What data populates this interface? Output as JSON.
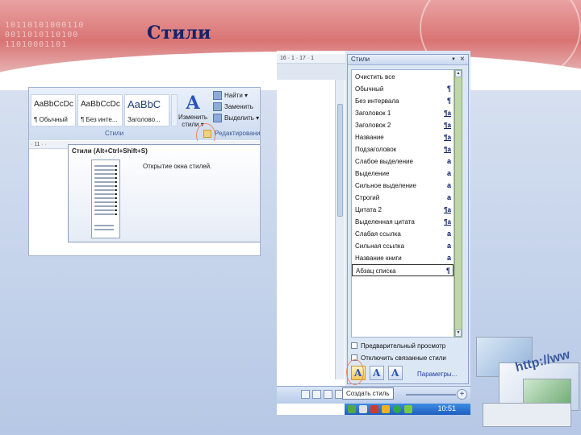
{
  "slide": {
    "title": "Стили",
    "banner_digits": [
      "10110101000110",
      "0011010110100",
      "11010001101"
    ],
    "illustration_text": "http://ww"
  },
  "left_screenshot": {
    "gallery": [
      {
        "sample": "AaBbCcDc",
        "name": "¶ Обычный"
      },
      {
        "sample": "AaBbCcDc",
        "name": "¶ Без инте..."
      },
      {
        "sample": "AaBbC",
        "name": "Заголово..."
      }
    ],
    "change_styles": {
      "label_line1": "Изменить",
      "label_line2": "стили ▾"
    },
    "editing": {
      "find": "Найти ▾",
      "replace": "Заменить",
      "select": "Выделить ▾"
    },
    "group_styles_label": "Стили",
    "group_edit_label": "Редактирование",
    "ruler_text": "· 11 · ·",
    "tooltip": {
      "title": "Стили (Alt+Ctrl+Shift+S)",
      "description": "Открытие окна стилей."
    }
  },
  "right_screenshot": {
    "ruler_text": "16 · 1 · 17 · 1",
    "pane_title": "Стили",
    "pane_dropdown": "▼",
    "pane_close": "×",
    "styles": [
      {
        "name": "Очистить все",
        "marker": ""
      },
      {
        "name": "Обычный",
        "marker": "¶"
      },
      {
        "name": "Без интервала",
        "marker": "¶"
      },
      {
        "name": "Заголовок 1",
        "marker": "¶a"
      },
      {
        "name": "Заголовок 2",
        "marker": "¶a"
      },
      {
        "name": "Название",
        "marker": "¶a"
      },
      {
        "name": "Подзаголовок",
        "marker": "¶a"
      },
      {
        "name": "Слабое выделение",
        "marker": "a"
      },
      {
        "name": "Выделение",
        "marker": "a"
      },
      {
        "name": "Сильное выделение",
        "marker": "a"
      },
      {
        "name": "Строгий",
        "marker": "a"
      },
      {
        "name": "Цитата 2",
        "marker": "¶a"
      },
      {
        "name": "Выделенная цитата",
        "marker": "¶a"
      },
      {
        "name": "Слабая ссылка",
        "marker": "a"
      },
      {
        "name": "Сильная ссылка",
        "marker": "a"
      },
      {
        "name": "Название книги",
        "marker": "a"
      },
      {
        "name": "Абзац списка",
        "marker": "¶"
      }
    ],
    "selected_style_index": 16,
    "options": {
      "preview": "Предварительный просмотр",
      "disable_linked": "Отключить связанные стили"
    },
    "params_link": "Параметры...",
    "create_style_tooltip": "Создать стиль",
    "zoom_plus": "+",
    "clock": "10:51",
    "colors": {
      "accent": "#2a55b8",
      "pane_bg": "#dce7f6",
      "scroll_green": "#bfd7a8"
    }
  }
}
